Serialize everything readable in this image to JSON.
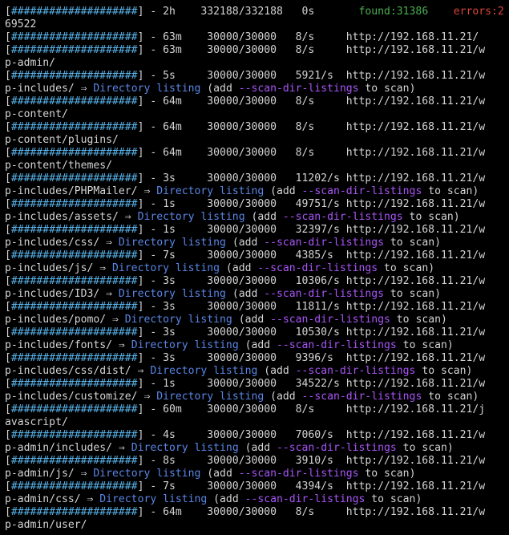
{
  "terminal": {
    "lines": [
      {
        "parts": [
          [
            "br",
            "["
          ],
          [
            "bar",
            "####################"
          ],
          [
            "br",
            "] - 2h    332188/332188   0s       "
          ],
          [
            "found",
            "found:31386"
          ],
          [
            "br",
            "    "
          ],
          [
            "err",
            "errors:2"
          ]
        ]
      },
      {
        "parts": [
          [
            "br",
            "69522"
          ]
        ]
      },
      {
        "parts": [
          [
            "br",
            "["
          ],
          [
            "bar",
            "####################"
          ],
          [
            "br",
            "] - 63m    30000/30000   8/s     http://192.168.11.21/"
          ]
        ]
      },
      {
        "parts": [
          [
            "br",
            "["
          ],
          [
            "bar",
            "####################"
          ],
          [
            "br",
            "] - 63m    30000/30000   8/s     http://192.168.11.21/w"
          ]
        ]
      },
      {
        "parts": [
          [
            "br",
            "p-admin/"
          ]
        ]
      },
      {
        "parts": [
          [
            "br",
            "["
          ],
          [
            "bar",
            "####################"
          ],
          [
            "br",
            "] - 5s     30000/30000   5921/s  http://192.168.11.21/w"
          ]
        ]
      },
      {
        "parts": [
          [
            "br",
            "p-includes/ "
          ],
          [
            "arrow",
            "⇒"
          ],
          [
            "br",
            " "
          ],
          [
            "listing",
            "Directory listing"
          ],
          [
            "br",
            " (add "
          ],
          [
            "opt",
            "--scan-dir-listings"
          ],
          [
            "br",
            " to scan)"
          ]
        ]
      },
      {
        "parts": [
          [
            "br",
            "["
          ],
          [
            "bar",
            "####################"
          ],
          [
            "br",
            "] - 64m    30000/30000   8/s     http://192.168.11.21/w"
          ]
        ]
      },
      {
        "parts": [
          [
            "br",
            "p-content/"
          ]
        ]
      },
      {
        "parts": [
          [
            "br",
            "["
          ],
          [
            "bar",
            "####################"
          ],
          [
            "br",
            "] - 64m    30000/30000   8/s     http://192.168.11.21/w"
          ]
        ]
      },
      {
        "parts": [
          [
            "br",
            "p-content/plugins/"
          ]
        ]
      },
      {
        "parts": [
          [
            "br",
            "["
          ],
          [
            "bar",
            "####################"
          ],
          [
            "br",
            "] - 64m    30000/30000   8/s     http://192.168.11.21/w"
          ]
        ]
      },
      {
        "parts": [
          [
            "br",
            "p-content/themes/"
          ]
        ]
      },
      {
        "parts": [
          [
            "br",
            "["
          ],
          [
            "bar",
            "####################"
          ],
          [
            "br",
            "] - 3s     30000/30000   11202/s http://192.168.11.21/w"
          ]
        ]
      },
      {
        "parts": [
          [
            "br",
            "p-includes/PHPMailer/ "
          ],
          [
            "arrow",
            "⇒"
          ],
          [
            "br",
            " "
          ],
          [
            "listing",
            "Directory listing"
          ],
          [
            "br",
            " (add "
          ],
          [
            "opt",
            "--scan-dir-listings"
          ],
          [
            "br",
            " to scan)"
          ]
        ]
      },
      {
        "parts": [
          [
            "br",
            "["
          ],
          [
            "bar",
            "####################"
          ],
          [
            "br",
            "] - 1s     30000/30000   49751/s http://192.168.11.21/w"
          ]
        ]
      },
      {
        "parts": [
          [
            "br",
            "p-includes/assets/ "
          ],
          [
            "arrow",
            "⇒"
          ],
          [
            "br",
            " "
          ],
          [
            "listing",
            "Directory listing"
          ],
          [
            "br",
            " (add "
          ],
          [
            "opt",
            "--scan-dir-listings"
          ],
          [
            "br",
            " to scan)"
          ]
        ]
      },
      {
        "parts": [
          [
            "br",
            "["
          ],
          [
            "bar",
            "####################"
          ],
          [
            "br",
            "] - 1s     30000/30000   32397/s http://192.168.11.21/w"
          ]
        ]
      },
      {
        "parts": [
          [
            "br",
            "p-includes/css/ "
          ],
          [
            "arrow",
            "⇒"
          ],
          [
            "br",
            " "
          ],
          [
            "listing",
            "Directory listing"
          ],
          [
            "br",
            " (add "
          ],
          [
            "opt",
            "--scan-dir-listings"
          ],
          [
            "br",
            " to scan)"
          ]
        ]
      },
      {
        "parts": [
          [
            "br",
            "["
          ],
          [
            "bar",
            "####################"
          ],
          [
            "br",
            "] - 7s     30000/30000   4385/s  http://192.168.11.21/w"
          ]
        ]
      },
      {
        "parts": [
          [
            "br",
            "p-includes/js/ "
          ],
          [
            "arrow",
            "⇒"
          ],
          [
            "br",
            " "
          ],
          [
            "listing",
            "Directory listing"
          ],
          [
            "br",
            " (add "
          ],
          [
            "opt",
            "--scan-dir-listings"
          ],
          [
            "br",
            " to scan)"
          ]
        ]
      },
      {
        "parts": [
          [
            "br",
            "["
          ],
          [
            "bar",
            "####################"
          ],
          [
            "br",
            "] - 3s     30000/30000   10306/s http://192.168.11.21/w"
          ]
        ]
      },
      {
        "parts": [
          [
            "br",
            "p-includes/ID3/ "
          ],
          [
            "arrow",
            "⇒"
          ],
          [
            "br",
            " "
          ],
          [
            "listing",
            "Directory listing"
          ],
          [
            "br",
            " (add "
          ],
          [
            "opt",
            "--scan-dir-listings"
          ],
          [
            "br",
            " to scan)"
          ]
        ]
      },
      {
        "parts": [
          [
            "br",
            "["
          ],
          [
            "bar",
            "####################"
          ],
          [
            "br",
            "] - 3s     30000/30000   11811/s http://192.168.11.21/w"
          ]
        ]
      },
      {
        "parts": [
          [
            "br",
            "p-includes/pomo/ "
          ],
          [
            "arrow",
            "⇒"
          ],
          [
            "br",
            " "
          ],
          [
            "listing",
            "Directory listing"
          ],
          [
            "br",
            " (add "
          ],
          [
            "opt",
            "--scan-dir-listings"
          ],
          [
            "br",
            " to scan)"
          ]
        ]
      },
      {
        "parts": [
          [
            "br",
            "["
          ],
          [
            "bar",
            "####################"
          ],
          [
            "br",
            "] - 3s     30000/30000   10530/s http://192.168.11.21/w"
          ]
        ]
      },
      {
        "parts": [
          [
            "br",
            "p-includes/fonts/ "
          ],
          [
            "arrow",
            "⇒"
          ],
          [
            "br",
            " "
          ],
          [
            "listing",
            "Directory listing"
          ],
          [
            "br",
            " (add "
          ],
          [
            "opt",
            "--scan-dir-listings"
          ],
          [
            "br",
            " to scan)"
          ]
        ]
      },
      {
        "parts": [
          [
            "br",
            "["
          ],
          [
            "bar",
            "####################"
          ],
          [
            "br",
            "] - 3s     30000/30000   9396/s  http://192.168.11.21/w"
          ]
        ]
      },
      {
        "parts": [
          [
            "br",
            "p-includes/css/dist/ "
          ],
          [
            "arrow",
            "⇒"
          ],
          [
            "br",
            " "
          ],
          [
            "listing",
            "Directory listing"
          ],
          [
            "br",
            " (add "
          ],
          [
            "opt",
            "--scan-dir-listings"
          ],
          [
            "br",
            " to scan)"
          ]
        ]
      },
      {
        "parts": [
          [
            "br",
            "["
          ],
          [
            "bar",
            "####################"
          ],
          [
            "br",
            "] - 1s     30000/30000   34522/s http://192.168.11.21/w"
          ]
        ]
      },
      {
        "parts": [
          [
            "br",
            "p-includes/customize/ "
          ],
          [
            "arrow",
            "⇒"
          ],
          [
            "br",
            " "
          ],
          [
            "listing",
            "Directory listing"
          ],
          [
            "br",
            " (add "
          ],
          [
            "opt",
            "--scan-dir-listings"
          ],
          [
            "br",
            " to scan)"
          ]
        ]
      },
      {
        "parts": [
          [
            "br",
            "["
          ],
          [
            "bar",
            "####################"
          ],
          [
            "br",
            "] - 60m    30000/30000   8/s     http://192.168.11.21/j"
          ]
        ]
      },
      {
        "parts": [
          [
            "br",
            "avascript/"
          ]
        ]
      },
      {
        "parts": [
          [
            "br",
            "["
          ],
          [
            "bar",
            "####################"
          ],
          [
            "br",
            "] - 4s     30000/30000   7060/s  http://192.168.11.21/w"
          ]
        ]
      },
      {
        "parts": [
          [
            "br",
            "p-admin/includes/ "
          ],
          [
            "arrow",
            "⇒"
          ],
          [
            "br",
            " "
          ],
          [
            "listing",
            "Directory listing"
          ],
          [
            "br",
            " (add "
          ],
          [
            "opt",
            "--scan-dir-listings"
          ],
          [
            "br",
            " to scan)"
          ]
        ]
      },
      {
        "parts": [
          [
            "br",
            "["
          ],
          [
            "bar",
            "####################"
          ],
          [
            "br",
            "] - 8s     30000/30000   3910/s  http://192.168.11.21/w"
          ]
        ]
      },
      {
        "parts": [
          [
            "br",
            "p-admin/js/ "
          ],
          [
            "arrow",
            "⇒"
          ],
          [
            "br",
            " "
          ],
          [
            "listing",
            "Directory listing"
          ],
          [
            "br",
            " (add "
          ],
          [
            "opt",
            "--scan-dir-listings"
          ],
          [
            "br",
            " to scan)"
          ]
        ]
      },
      {
        "parts": [
          [
            "br",
            "["
          ],
          [
            "bar",
            "####################"
          ],
          [
            "br",
            "] - 7s     30000/30000   4394/s  http://192.168.11.21/w"
          ]
        ]
      },
      {
        "parts": [
          [
            "br",
            "p-admin/css/ "
          ],
          [
            "arrow",
            "⇒"
          ],
          [
            "br",
            " "
          ],
          [
            "listing",
            "Directory listing"
          ],
          [
            "br",
            " (add "
          ],
          [
            "opt",
            "--scan-dir-listings"
          ],
          [
            "br",
            " to scan)"
          ]
        ]
      },
      {
        "parts": [
          [
            "br",
            "["
          ],
          [
            "bar",
            "####################"
          ],
          [
            "br",
            "] - 64m    30000/30000   8/s     http://192.168.11.21/w"
          ]
        ]
      },
      {
        "parts": [
          [
            "br",
            "p-admin/user/"
          ]
        ]
      }
    ]
  }
}
